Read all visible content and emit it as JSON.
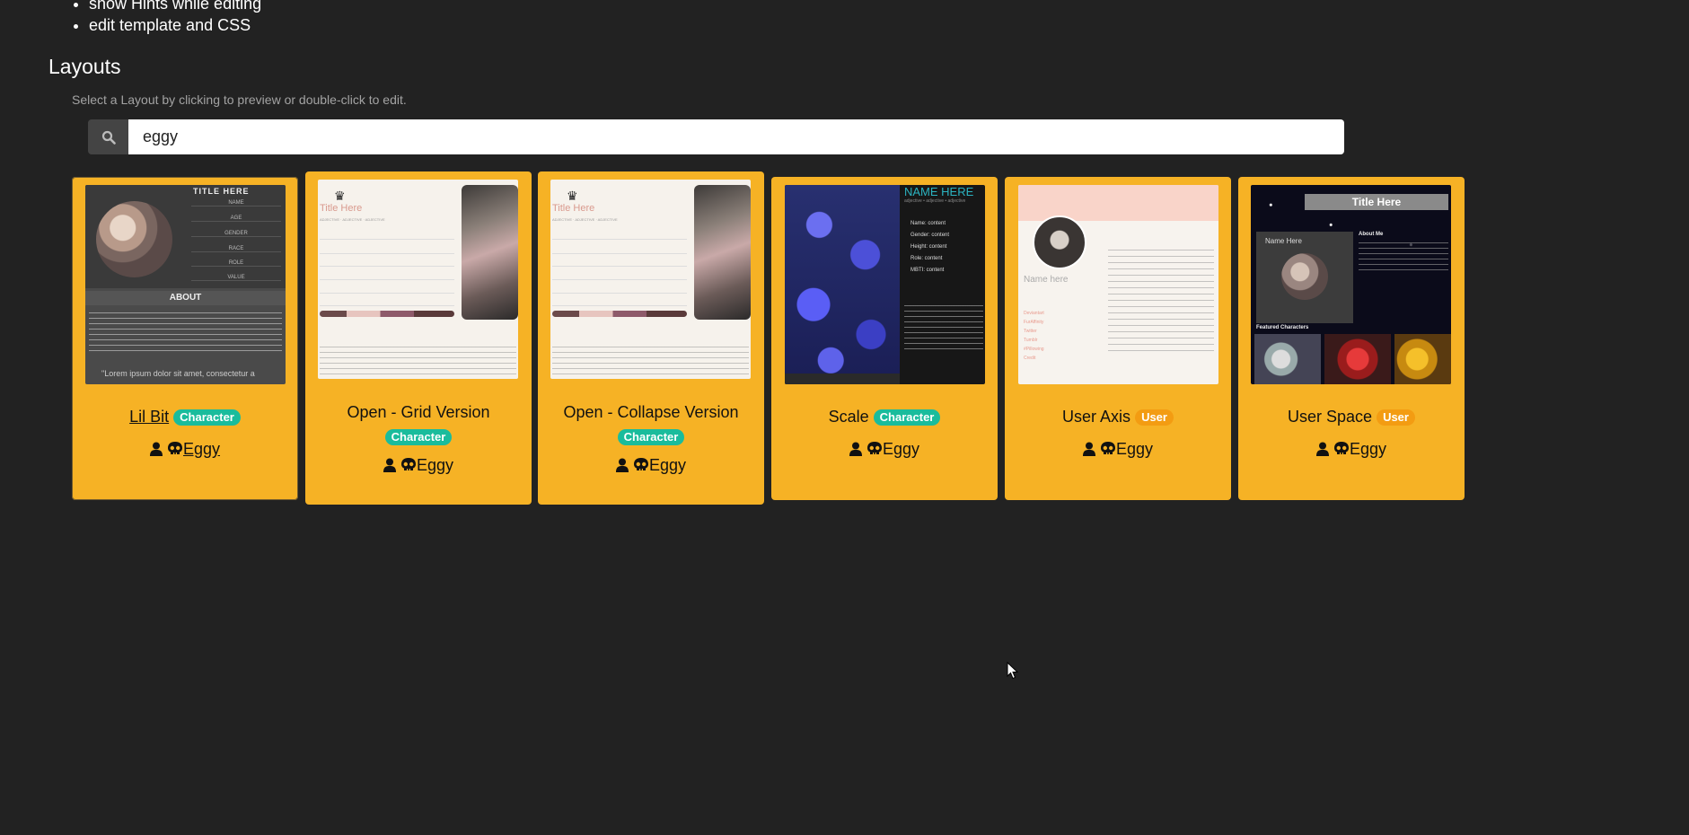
{
  "hints": {
    "items": [
      "show Hints while editing",
      "edit template and CSS"
    ]
  },
  "layouts": {
    "title": "Layouts",
    "subtitle": "Select a Layout by clicking to preview or double-click to edit.",
    "search": {
      "value": "eggy",
      "icon": "search-icon"
    },
    "cards": [
      {
        "name": "Lil Bit",
        "type": "Character",
        "author": "Eggy",
        "thumb": {
          "title": "TITLE HERE",
          "fields": [
            "NAME",
            "AGE",
            "GENDER",
            "RACE",
            "ROLE",
            "VALUE"
          ],
          "section": "ABOUT",
          "quote": "\"Lorem ipsum dolor sit amet, consectetur a"
        }
      },
      {
        "name": "Open - Grid Version",
        "type": "Character",
        "author": "Eggy",
        "thumb": {
          "title": "Title Here",
          "subtitle": "ADJECTIVE · ADJECTIVE · ADJECTIVE"
        }
      },
      {
        "name": "Open - Collapse Version",
        "type": "Character",
        "author": "Eggy",
        "thumb": {
          "title": "Title Here",
          "subtitle": "ADJECTIVE · ADJECTIVE · ADJECTIVE"
        }
      },
      {
        "name": "Scale",
        "type": "Character",
        "author": "Eggy",
        "thumb": {
          "title": "NAME HERE",
          "subtitle": "adjective • adjective • adjective",
          "fields": [
            "Name: content",
            "Gender: content",
            "Height: content",
            "Role: content",
            "MBTI: content"
          ]
        }
      },
      {
        "name": "User Axis",
        "type": "User",
        "author": "Eggy",
        "thumb": {
          "name": "Name here",
          "links": [
            "Deviantart",
            "FurAffinity",
            "Twitter",
            "Tumblr",
            "#Pillowing",
            "Credit"
          ]
        }
      },
      {
        "name": "User Space",
        "type": "User",
        "author": "Eggy",
        "thumb": {
          "title": "Title Here",
          "name": "Name Here",
          "about": "About Me",
          "featured": "Featured Characters"
        }
      }
    ]
  },
  "colors": {
    "background": "#222222",
    "card": "#f6b225",
    "badge_character": "#1abc9c",
    "badge_user": "#f39c12"
  }
}
